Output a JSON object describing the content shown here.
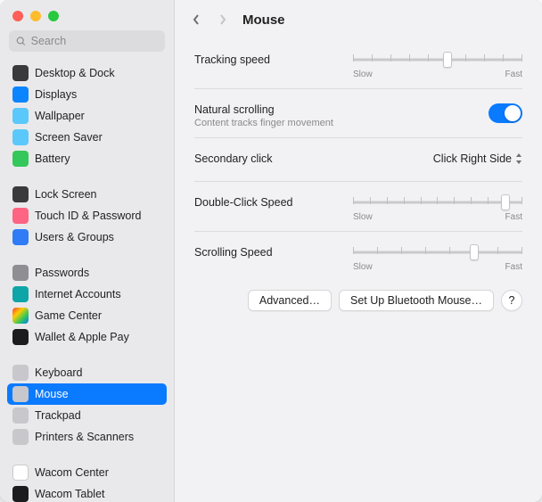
{
  "window": {
    "title": "Mouse"
  },
  "search": {
    "placeholder": "Search"
  },
  "sidebar": {
    "groups": [
      {
        "items": [
          {
            "label": "Desktop & Dock",
            "icon": "desktop-icon",
            "iconClass": "ic-black"
          },
          {
            "label": "Displays",
            "icon": "displays-icon",
            "iconClass": "ic-blue"
          },
          {
            "label": "Wallpaper",
            "icon": "wallpaper-icon",
            "iconClass": "ic-cyan"
          },
          {
            "label": "Screen Saver",
            "icon": "screensaver-icon",
            "iconClass": "ic-cyan"
          },
          {
            "label": "Battery",
            "icon": "battery-icon",
            "iconClass": "ic-green"
          }
        ]
      },
      {
        "items": [
          {
            "label": "Lock Screen",
            "icon": "lock-icon",
            "iconClass": "ic-black"
          },
          {
            "label": "Touch ID & Password",
            "icon": "touchid-icon",
            "iconClass": "ic-pink"
          },
          {
            "label": "Users & Groups",
            "icon": "users-icon",
            "iconClass": "ic-bluesq"
          }
        ]
      },
      {
        "items": [
          {
            "label": "Passwords",
            "icon": "passwords-icon",
            "iconClass": "ic-gray"
          },
          {
            "label": "Internet Accounts",
            "icon": "internet-icon",
            "iconClass": "ic-teal"
          },
          {
            "label": "Game Center",
            "icon": "gamecenter-icon",
            "iconClass": "ic-multi"
          },
          {
            "label": "Wallet & Apple Pay",
            "icon": "wallet-icon",
            "iconClass": "ic-dark"
          }
        ]
      },
      {
        "items": [
          {
            "label": "Keyboard",
            "icon": "keyboard-icon",
            "iconClass": "ic-lgray"
          },
          {
            "label": "Mouse",
            "icon": "mouse-icon",
            "iconClass": "ic-lgray",
            "selected": true
          },
          {
            "label": "Trackpad",
            "icon": "trackpad-icon",
            "iconClass": "ic-lgray"
          },
          {
            "label": "Printers & Scanners",
            "icon": "printers-icon",
            "iconClass": "ic-lgray"
          }
        ]
      },
      {
        "items": [
          {
            "label": "Wacom Center",
            "icon": "wacom-center-icon",
            "iconClass": "ic-white"
          },
          {
            "label": "Wacom Tablet",
            "icon": "wacom-tablet-icon",
            "iconClass": "ic-dark"
          }
        ]
      }
    ]
  },
  "settings": {
    "tracking": {
      "label": "Tracking speed",
      "slow": "Slow",
      "fast": "Fast",
      "ticks": 10,
      "value": 5
    },
    "natural": {
      "label": "Natural scrolling",
      "sub": "Content tracks finger movement",
      "on": true
    },
    "secondary": {
      "label": "Secondary click",
      "value": "Click Right Side"
    },
    "doubleclick": {
      "label": "Double-Click Speed",
      "slow": "Slow",
      "fast": "Fast",
      "ticks": 11,
      "value": 9
    },
    "scrolling": {
      "label": "Scrolling Speed",
      "slow": "Slow",
      "fast": "Fast",
      "ticks": 8,
      "value": 5
    }
  },
  "buttons": {
    "advanced": "Advanced…",
    "bluetooth": "Set Up Bluetooth Mouse…",
    "help": "?"
  }
}
